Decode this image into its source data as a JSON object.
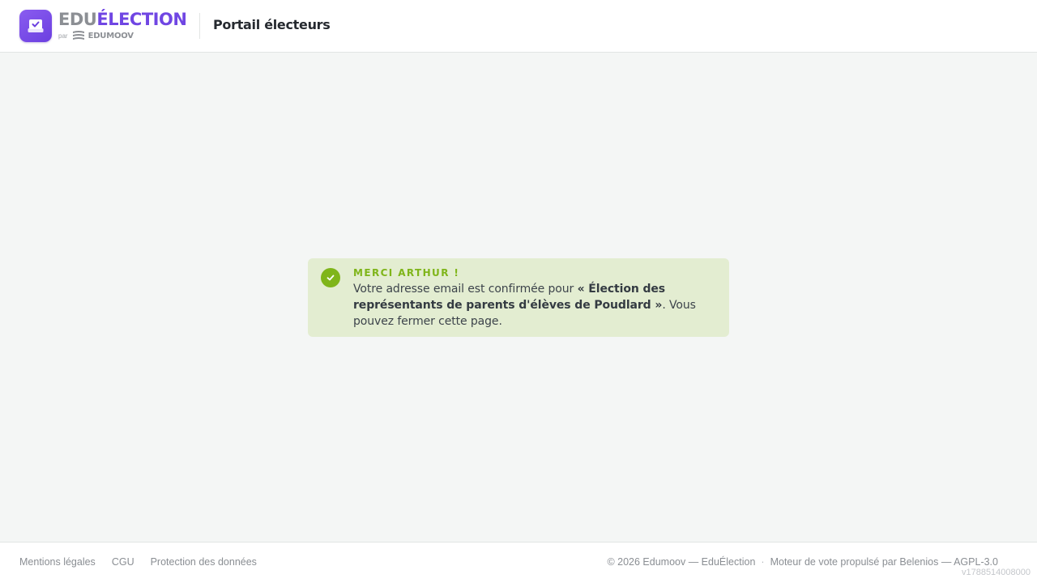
{
  "header": {
    "brand_edu": "EDU",
    "brand_election": "ÉLECTION",
    "brand_par": "par",
    "brand_edumoov": "EDUMOOV",
    "portal_title": "Portail électeurs",
    "logo_icon": "ballot-box-check-icon"
  },
  "notice": {
    "icon": "check-circle-icon",
    "title": "MERCI ARTHUR !",
    "body_prefix": "Votre adresse email est confirmée pour ",
    "election_name": "« Élection des représentants de parents d'élèves de Poudlard »",
    "body_suffix": ". Vous pouvez fermer cette page.",
    "colors": {
      "background": "#e3edd1",
      "accent": "#7fb51a"
    }
  },
  "footer": {
    "links": [
      "Mentions légales",
      "CGU",
      "Protection des données"
    ],
    "copyright": "© 2026 Edumoov — EduÉlection",
    "separator": "·",
    "engine": "Moteur de vote propulsé par Belenios — AGPL-3.0",
    "version": "v1788514008000"
  },
  "colors": {
    "brand_purple": "#7046e3",
    "page_background": "#f4f6f5"
  }
}
